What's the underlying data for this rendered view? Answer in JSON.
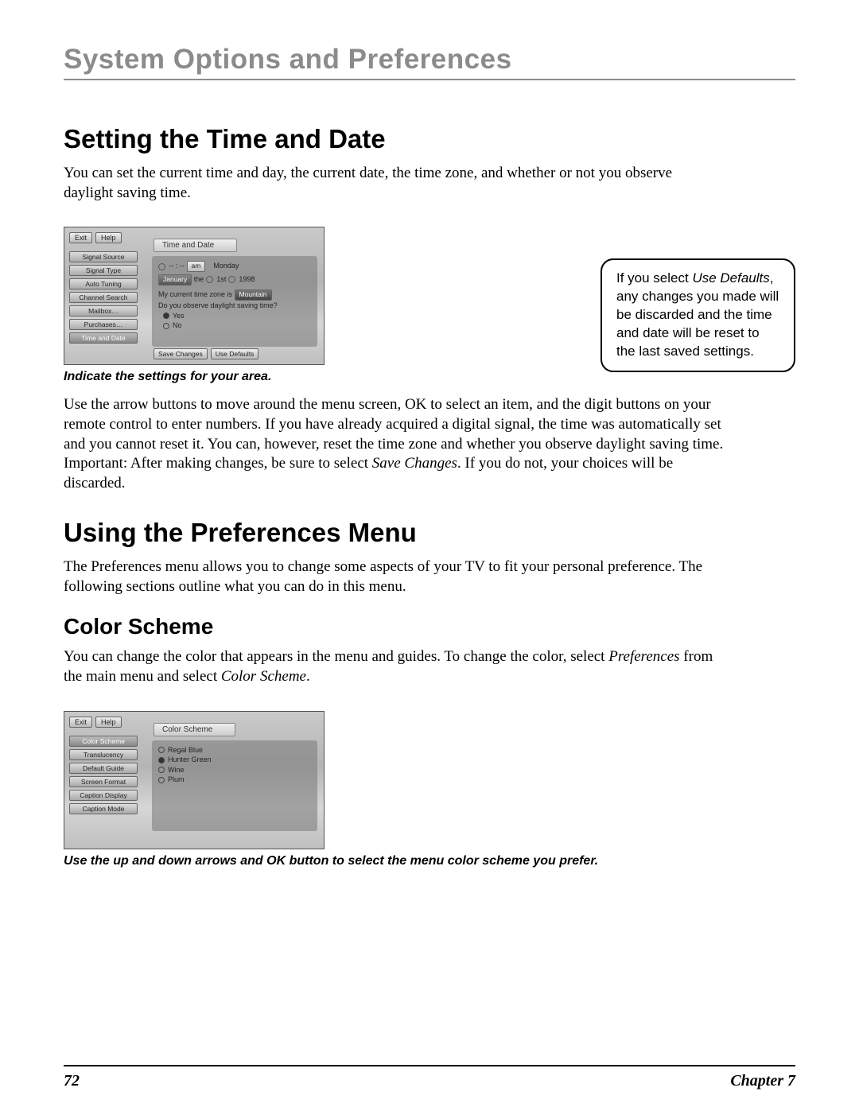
{
  "page_title": "System Options and Preferences",
  "section1": {
    "heading": "Setting the Time and Date",
    "intro": "You can set the current time and day, the current date, the time zone, and whether or not you observe daylight saving time.",
    "caption": "Indicate the settings for your area.",
    "body_pre": "Use the arrow buttons to move around the menu screen, OK to select an item, and the digit buttons on your remote control to enter numbers. If you have already acquired a digital signal, the time was automatically set and you cannot reset it. You can, however, reset the time zone and whether you observe daylight saving time. Important: After making changes, be sure to select ",
    "body_em": "Save Changes",
    "body_post": ". If you do not, your choices will be discarded."
  },
  "callout": {
    "pre": "If you select ",
    "em": "Use Defaults",
    "post": ", any changes you made will be discarded and the time and date will be reset to the last saved settings."
  },
  "screenshot1": {
    "top": {
      "exit": "Exit",
      "help": "Help"
    },
    "panel_title": "Time and Date",
    "side": [
      "Signal Source",
      "Signal Type",
      "Auto Tuning",
      "Channel Search",
      "Mailbox…",
      "Purchases…",
      "Time and Date"
    ],
    "row1": {
      "time": "-- : --",
      "ampm": "am",
      "day": "Monday"
    },
    "row2": {
      "month": "January",
      "the": "the",
      "date": "1st",
      "year": "1998"
    },
    "tz_pre": "My current time zone is ",
    "tz_value": "Mountain",
    "dst_q": "Do you observe daylight saving time?",
    "yes": "Yes",
    "no": "No",
    "bottom": {
      "save": "Save Changes",
      "defaults": "Use Defaults"
    }
  },
  "section2": {
    "heading": "Using the Preferences Menu",
    "intro": "The Preferences menu allows you to change some aspects of your TV to fit your personal preference. The following sections outline what you can do in this menu."
  },
  "section3": {
    "heading": "Color Scheme",
    "body_pre1": "You can change the color that appears in the menu and guides. To change the color, select ",
    "em1": "Preferences",
    "body_mid": " from the main menu and select ",
    "em2": "Color Scheme",
    "body_post": ".",
    "caption": "Use the up and down arrows and OK button to select the menu color scheme you prefer."
  },
  "screenshot2": {
    "top": {
      "exit": "Exit",
      "help": "Help"
    },
    "panel_title": "Color Scheme",
    "side": [
      "Color Scheme",
      "Translucency",
      "Default Guide",
      "Screen Format",
      "Caption Display",
      "Caption Mode"
    ],
    "options": [
      "Regal Blue",
      "Hunter Green",
      "Wine",
      "Plum"
    ],
    "selected_index": 1
  },
  "footer": {
    "page": "72",
    "chapter": "Chapter 7"
  }
}
